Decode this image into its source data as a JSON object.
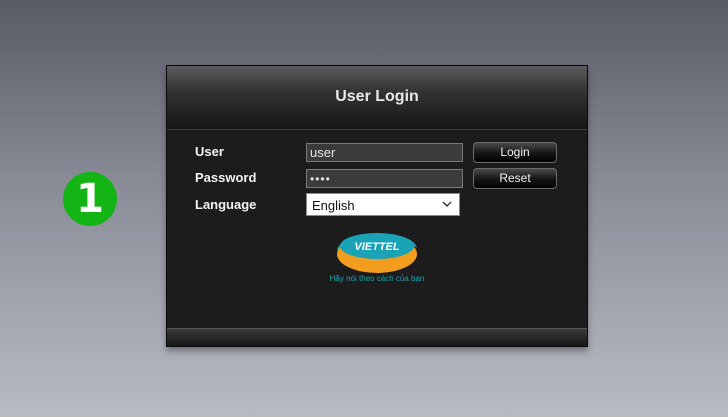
{
  "step_badge": "1",
  "login_panel": {
    "title": "User Login",
    "user_label": "User",
    "user_value": "user",
    "password_label": "Password",
    "password_value": "abcd",
    "language_label": "Language",
    "language_selected": "English",
    "login_button": "Login",
    "reset_button": "Reset",
    "logo": {
      "text": "VIETTEL",
      "tagline": "Hãy nói theo cách của bạn"
    }
  },
  "colors": {
    "badge_green": "#12b514",
    "panel_bg": "#1c1c1c",
    "logo_teal": "#1aa3b5",
    "logo_orange": "#f29d1d"
  },
  "icons": {
    "select_arrow": "chevron-down-icon",
    "badge": "step-number-badge"
  }
}
